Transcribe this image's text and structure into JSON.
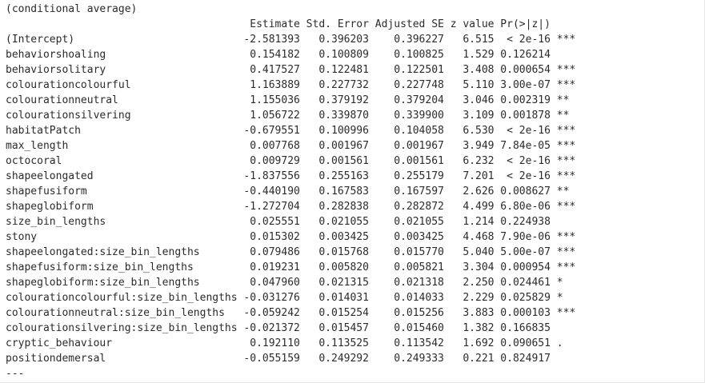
{
  "console": {
    "header": "(conditional average)",
    "columns": [
      "Estimate",
      "Std. Error",
      "Adjusted SE",
      "z value",
      "Pr(>|z|)"
    ],
    "rows": [
      {
        "term": "(Intercept)",
        "estimate": "-2.581393",
        "std_error": "0.396203",
        "adjusted_se": "0.396227",
        "z_value": "6.515",
        "p_value": "< 2e-16",
        "signif": "***"
      },
      {
        "term": "behaviorshoaling",
        "estimate": "0.154182",
        "std_error": "0.100809",
        "adjusted_se": "0.100825",
        "z_value": "1.529",
        "p_value": "0.126214",
        "signif": ""
      },
      {
        "term": "behaviorsolitary",
        "estimate": "0.417527",
        "std_error": "0.122481",
        "adjusted_se": "0.122501",
        "z_value": "3.408",
        "p_value": "0.000654",
        "signif": "***"
      },
      {
        "term": "colourationcolourful",
        "estimate": "1.163889",
        "std_error": "0.227732",
        "adjusted_se": "0.227748",
        "z_value": "5.110",
        "p_value": "3.00e-07",
        "signif": "***"
      },
      {
        "term": "colourationneutral",
        "estimate": "1.155036",
        "std_error": "0.379192",
        "adjusted_se": "0.379204",
        "z_value": "3.046",
        "p_value": "0.002319",
        "signif": "**"
      },
      {
        "term": "colourationsilvering",
        "estimate": "1.056722",
        "std_error": "0.339870",
        "adjusted_se": "0.339900",
        "z_value": "3.109",
        "p_value": "0.001878",
        "signif": "**"
      },
      {
        "term": "habitatPatch",
        "estimate": "-0.679551",
        "std_error": "0.100996",
        "adjusted_se": "0.104058",
        "z_value": "6.530",
        "p_value": "< 2e-16",
        "signif": "***"
      },
      {
        "term": "max_length",
        "estimate": "0.007768",
        "std_error": "0.001967",
        "adjusted_se": "0.001967",
        "z_value": "3.949",
        "p_value": "7.84e-05",
        "signif": "***"
      },
      {
        "term": "octocoral",
        "estimate": "0.009729",
        "std_error": "0.001561",
        "adjusted_se": "0.001561",
        "z_value": "6.232",
        "p_value": "< 2e-16",
        "signif": "***"
      },
      {
        "term": "shapeelongated",
        "estimate": "-1.837556",
        "std_error": "0.255163",
        "adjusted_se": "0.255179",
        "z_value": "7.201",
        "p_value": "< 2e-16",
        "signif": "***"
      },
      {
        "term": "shapefusiform",
        "estimate": "-0.440190",
        "std_error": "0.167583",
        "adjusted_se": "0.167597",
        "z_value": "2.626",
        "p_value": "0.008627",
        "signif": "**"
      },
      {
        "term": "shapeglobiform",
        "estimate": "-1.272704",
        "std_error": "0.282838",
        "adjusted_se": "0.282872",
        "z_value": "4.499",
        "p_value": "6.80e-06",
        "signif": "***"
      },
      {
        "term": "size_bin_lengths",
        "estimate": "0.025551",
        "std_error": "0.021055",
        "adjusted_se": "0.021055",
        "z_value": "1.214",
        "p_value": "0.224938",
        "signif": ""
      },
      {
        "term": "stony",
        "estimate": "0.015302",
        "std_error": "0.003425",
        "adjusted_se": "0.003425",
        "z_value": "4.468",
        "p_value": "7.90e-06",
        "signif": "***"
      },
      {
        "term": "shapeelongated:size_bin_lengths",
        "estimate": "0.079486",
        "std_error": "0.015768",
        "adjusted_se": "0.015770",
        "z_value": "5.040",
        "p_value": "5.00e-07",
        "signif": "***"
      },
      {
        "term": "shapefusiform:size_bin_lengths",
        "estimate": "0.019231",
        "std_error": "0.005820",
        "adjusted_se": "0.005821",
        "z_value": "3.304",
        "p_value": "0.000954",
        "signif": "***"
      },
      {
        "term": "shapeglobiform:size_bin_lengths",
        "estimate": "0.047960",
        "std_error": "0.021315",
        "adjusted_se": "0.021318",
        "z_value": "2.250",
        "p_value": "0.024461",
        "signif": "*"
      },
      {
        "term": "colourationcolourful:size_bin_lengths",
        "estimate": "-0.031276",
        "std_error": "0.014031",
        "adjusted_se": "0.014033",
        "z_value": "2.229",
        "p_value": "0.025829",
        "signif": "*"
      },
      {
        "term": "colourationneutral:size_bin_lengths",
        "estimate": "-0.059242",
        "std_error": "0.015254",
        "adjusted_se": "0.015256",
        "z_value": "3.883",
        "p_value": "0.000103",
        "signif": "***"
      },
      {
        "term": "colourationsilvering:size_bin_lengths",
        "estimate": "-0.021372",
        "std_error": "0.015457",
        "adjusted_se": "0.015460",
        "z_value": "1.382",
        "p_value": "0.166835",
        "signif": ""
      },
      {
        "term": "cryptic_behaviour",
        "estimate": "0.192110",
        "std_error": "0.113525",
        "adjusted_se": "0.113542",
        "z_value": "1.692",
        "p_value": "0.090651",
        "signif": "."
      },
      {
        "term": "positiondemersal",
        "estimate": "-0.055159",
        "std_error": "0.249292",
        "adjusted_se": "0.249333",
        "z_value": "0.221",
        "p_value": "0.824917",
        "signif": ""
      }
    ],
    "footer": "---"
  }
}
